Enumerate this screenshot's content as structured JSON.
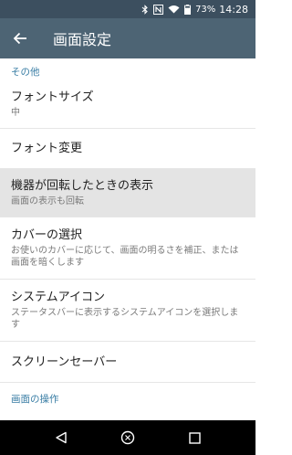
{
  "status_bar": {
    "battery": "73%",
    "time": "14:28",
    "icons": [
      "bluetooth-icon",
      "nfc-icon",
      "wifi-icon",
      "battery-icon"
    ]
  },
  "app_bar": {
    "title": "画面設定",
    "back_icon": "arrow-left-icon"
  },
  "sections": [
    {
      "header": "その他",
      "items": [
        {
          "title": "フォントサイズ",
          "subtitle": "中"
        },
        {
          "title": "フォント変更",
          "subtitle": ""
        },
        {
          "title": "機器が回転したときの表示",
          "subtitle": "画面の表示も回転",
          "highlighted": true
        },
        {
          "title": "カバーの選択",
          "subtitle": "お使いのカバーに応じて、画面の明るさを補正、または画面を暗くします"
        },
        {
          "title": "システムアイコン",
          "subtitle": "ステータスバーに表示するシステムアイコンを選択します"
        },
        {
          "title": "スクリーンセーバー",
          "subtitle": ""
        }
      ]
    },
    {
      "header": "画面の操作",
      "items": []
    }
  ],
  "nav_bar": {
    "icons": [
      "back-triangle-icon",
      "home-circle-icon",
      "recents-square-icon"
    ]
  },
  "colors": {
    "status_bar": "#3c4f5f",
    "app_bar": "#4d6474",
    "accent": "#3a7ea5",
    "highlight": "#e4e4e4"
  }
}
